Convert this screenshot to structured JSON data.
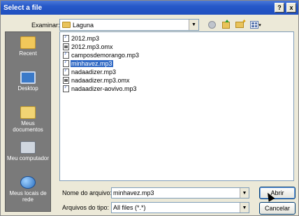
{
  "window": {
    "title": "Select a file"
  },
  "titlebar_buttons": {
    "help": "?",
    "close": "x"
  },
  "look_in": {
    "label": "Examinar:",
    "value": "Laguna"
  },
  "places": [
    {
      "label": "Recent",
      "icon": "recent-icon"
    },
    {
      "label": "Desktop",
      "icon": "desktop-icon"
    },
    {
      "label": "Meus documentos",
      "icon": "my-documents-icon"
    },
    {
      "label": "Meu computador",
      "icon": "my-computer-icon"
    },
    {
      "label": "Meus locais de rede",
      "icon": "network-places-icon"
    }
  ],
  "files": [
    {
      "name": "2012.mp3",
      "type": "audio"
    },
    {
      "name": "2012.mp3.omx",
      "type": "omx"
    },
    {
      "name": "camposdemorango.mp3",
      "type": "audio"
    },
    {
      "name": "minhavez.mp3",
      "type": "audio",
      "selected": true
    },
    {
      "name": "nadaadizer.mp3",
      "type": "audio"
    },
    {
      "name": "nadaadizer.mp3.omx",
      "type": "omx"
    },
    {
      "name": "nadaadizer-aovivo.mp3",
      "type": "audio"
    }
  ],
  "filename": {
    "label": "Nome do arquivo:",
    "value": "minhavez.mp3"
  },
  "filetype": {
    "label": "Arquivos do tipo:",
    "value": "All files (*.*)"
  },
  "buttons": {
    "open": "Abrir",
    "cancel": "Cancelar"
  },
  "colors": {
    "titlebar": "#2658c8",
    "selection": "#316ac5",
    "sidebar": "#7a7a7a"
  }
}
